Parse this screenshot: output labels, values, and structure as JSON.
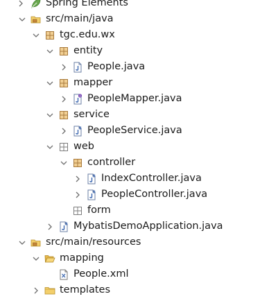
{
  "colors": {
    "twistie": "#6f6f6f",
    "package": "#a87a3c",
    "package_empty": "#7d7d7d",
    "folder": "#e8b94a",
    "java_file_blue": "#3a66b0",
    "interface_purple": "#7a4bb5",
    "spring_green": "#6aa84f"
  },
  "tree": [
    {
      "label": "Spring Elements",
      "icon": "spring-leaf-icon",
      "expanded": false
    },
    {
      "label": "src/main/java",
      "icon": "source-folder-icon",
      "expanded": true
    },
    {
      "label": "tgc.edu.wx",
      "icon": "package-icon",
      "expanded": true
    },
    {
      "label": "entity",
      "icon": "package-icon",
      "expanded": true
    },
    {
      "label": "People.java",
      "icon": "java-file-icon",
      "expanded": false
    },
    {
      "label": "mapper",
      "icon": "package-icon",
      "expanded": true
    },
    {
      "label": "PeopleMapper.java",
      "icon": "java-interface-file-icon",
      "expanded": false
    },
    {
      "label": "service",
      "icon": "package-icon",
      "expanded": true
    },
    {
      "label": "PeopleService.java",
      "icon": "spring-java-file-icon",
      "expanded": false
    },
    {
      "label": "web",
      "icon": "empty-package-icon",
      "expanded": true
    },
    {
      "label": "controller",
      "icon": "package-icon",
      "expanded": true
    },
    {
      "label": "IndexController.java",
      "icon": "spring-java-file-icon",
      "expanded": false
    },
    {
      "label": "PeopleController.java",
      "icon": "spring-java-file-icon",
      "expanded": false
    },
    {
      "label": "form",
      "icon": "empty-package-icon",
      "expanded": false
    },
    {
      "label": "MybatisDemoApplication.java",
      "icon": "spring-java-file-icon",
      "expanded": false
    },
    {
      "label": "src/main/resources",
      "icon": "source-folder-icon",
      "expanded": true
    },
    {
      "label": "mapping",
      "icon": "open-folder-icon",
      "expanded": true
    },
    {
      "label": "People.xml",
      "icon": "xml-file-icon",
      "expanded": false
    },
    {
      "label": "templates",
      "icon": "folder-icon",
      "expanded": false
    }
  ]
}
